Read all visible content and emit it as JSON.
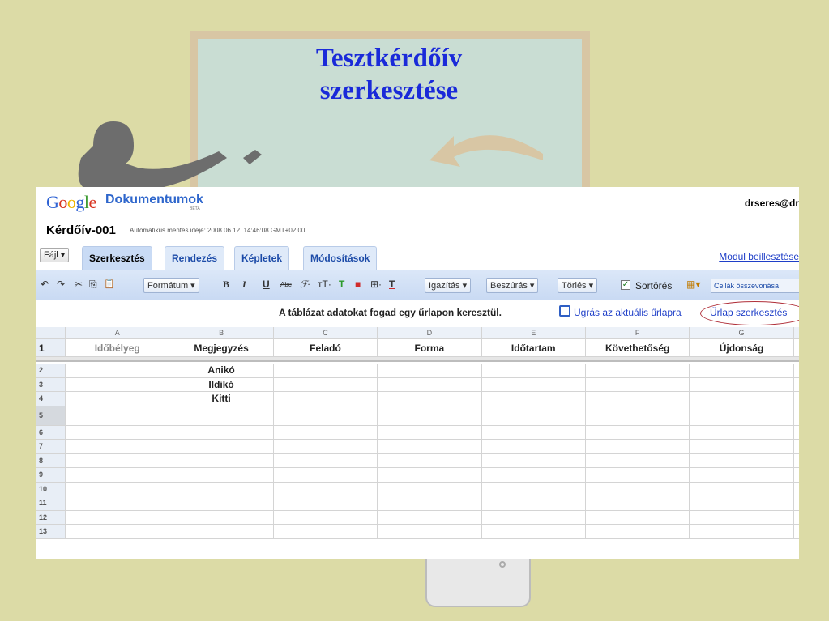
{
  "slide": {
    "title_line1": "Tesztkérdőív",
    "title_line2": "szerkesztése"
  },
  "colors": {
    "title": "#1a2ad9",
    "background": "#dcdba6",
    "tab_active": "#c9dbf5",
    "link": "#1f3fc8",
    "highlight_circle": "#b0303a"
  },
  "header": {
    "logo": {
      "g1": "G",
      "o1": "o",
      "o2": "o",
      "g2": "g",
      "l": "l",
      "e": "e"
    },
    "product": "Dokumentumok",
    "beta": "BETA",
    "user": "drseres@dr"
  },
  "document": {
    "title": "Kérdőív-001",
    "autosave": "Automatikus mentés ideje: 2008.06.12. 14:46:08 GMT+02:00"
  },
  "menu": {
    "file": "Fájl ▾",
    "tabs": [
      {
        "label": "Szerkesztés",
        "active": true
      },
      {
        "label": "Rendezés"
      },
      {
        "label": "Képletek"
      },
      {
        "label": "Módosítások"
      }
    ],
    "module_link": "Modul beillesztése"
  },
  "toolbar": {
    "undo": "↶",
    "redo": "↷",
    "cut": "✂",
    "copy": "⎘",
    "paste": "📋",
    "format": "Formátum ▾",
    "bold": "B",
    "italic": "I",
    "underline": "U",
    "strike": "Abc",
    "font": "ℱ·",
    "size": "тT·",
    "text_color": "T",
    "fill": "■",
    "border": "⊞·",
    "clear": "T",
    "align": "Igazítás ▾",
    "insert": "Beszúrás ▾",
    "delete": "Törlés ▾",
    "sort_label": "Sortörés",
    "chart_icon": "▦▾",
    "merge": "Cellák összevonása"
  },
  "form_bar": {
    "message": "A táblázat adatokat fogad egy űrlapon keresztül.",
    "jump_link": "Ugrás az aktuális űrlapra",
    "edit_link": "Űrlap szerkesztés"
  },
  "sheet": {
    "column_letters": [
      "A",
      "B",
      "C",
      "D",
      "E",
      "F",
      "G"
    ],
    "header_row_number": "1",
    "headers": [
      "Időbélyeg",
      "Megjegyzés",
      "Feladó",
      "Forma",
      "Időtartam",
      "Követhetőség",
      "Újdonság"
    ],
    "rows": [
      {
        "num": "2",
        "cells": [
          "",
          "Anikó",
          "",
          "",
          "",
          "",
          ""
        ]
      },
      {
        "num": "3",
        "cells": [
          "",
          "Ildikó",
          "",
          "",
          "",
          "",
          ""
        ]
      },
      {
        "num": "4",
        "cells": [
          "",
          "Kitti",
          "",
          "",
          "",
          "",
          ""
        ]
      },
      {
        "num": "5",
        "cells": [
          "",
          "",
          "",
          "",
          "",
          "",
          ""
        ]
      },
      {
        "num": "6",
        "cells": [
          "",
          "",
          "",
          "",
          "",
          "",
          ""
        ]
      },
      {
        "num": "7",
        "cells": [
          "",
          "",
          "",
          "",
          "",
          "",
          ""
        ]
      },
      {
        "num": "8",
        "cells": [
          "",
          "",
          "",
          "",
          "",
          "",
          ""
        ]
      },
      {
        "num": "9",
        "cells": [
          "",
          "",
          "",
          "",
          "",
          "",
          ""
        ]
      },
      {
        "num": "10",
        "cells": [
          "",
          "",
          "",
          "",
          "",
          "",
          ""
        ]
      },
      {
        "num": "11",
        "cells": [
          "",
          "",
          "",
          "",
          "",
          "",
          ""
        ]
      },
      {
        "num": "12",
        "cells": [
          "",
          "",
          "",
          "",
          "",
          "",
          ""
        ]
      },
      {
        "num": "13",
        "cells": [
          "",
          "",
          "",
          "",
          "",
          "",
          ""
        ]
      }
    ]
  }
}
